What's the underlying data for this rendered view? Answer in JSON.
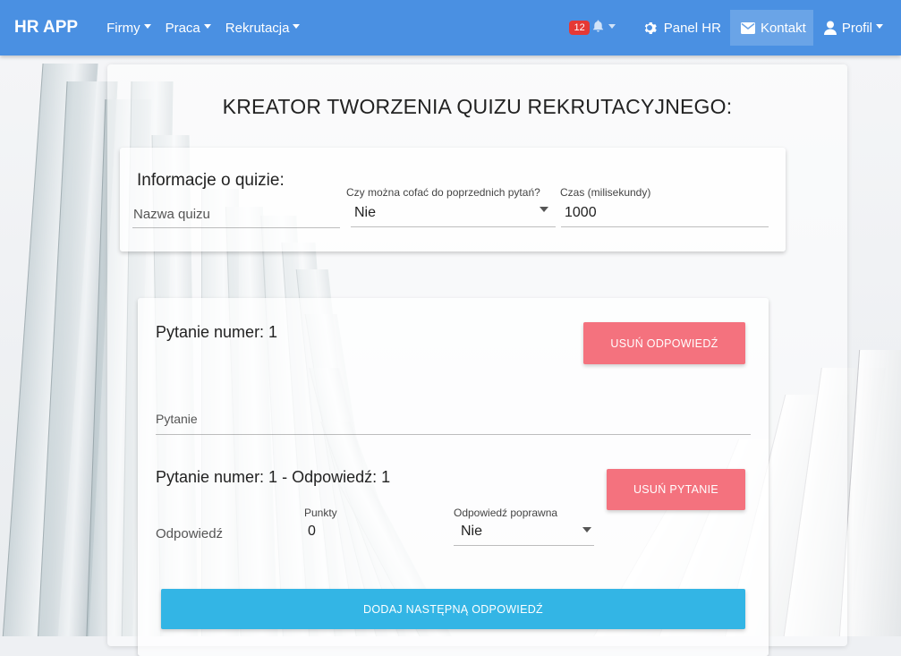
{
  "navbar": {
    "brand": "HR APP",
    "menus": [
      "Firmy",
      "Praca",
      "Rekrutacja"
    ],
    "notification_count": "12",
    "panel_hr": "Panel HR",
    "kontakt": "Kontakt",
    "profil": "Profil"
  },
  "page": {
    "title": "KREATOR TWORZENIA QUIZU REKRUTACYJNEGO:"
  },
  "info": {
    "heading": "Informacje o quizie:",
    "name_placeholder": "Nazwa quizu",
    "back_label": "Czy można cofać do poprzednich pytań?",
    "back_value": "Nie",
    "time_label": "Czas (milisekundy)",
    "time_value": "1000"
  },
  "question": {
    "title": "Pytanie numer: 1",
    "remove_answer_button": "USUŃ ODPOWIEDŹ",
    "question_placeholder": "Pytanie",
    "answer_title": "Pytanie numer: 1 - Odpowiedź: 1",
    "remove_question_button": "USUŃ PYTANIE",
    "answer_placeholder": "Odpowiedź",
    "points_label": "Punkty",
    "points_value": "0",
    "correct_label": "Odpowiedź poprawna",
    "correct_value": "Nie",
    "add_answer_button": "DODAJ NASTĘPNĄ ODPOWIEDŹ"
  },
  "colors": {
    "navbar": "#4a90e2",
    "danger": "#f4727e",
    "info": "#33b5e5",
    "badge": "#e53935"
  },
  "icons": [
    "bell-icon",
    "gear-icon",
    "envelope-icon",
    "user-icon"
  ]
}
